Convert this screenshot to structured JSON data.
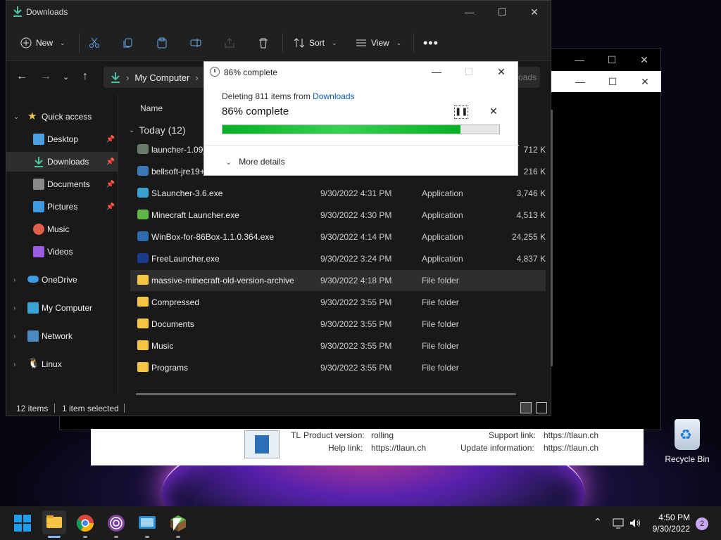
{
  "explorer": {
    "title": "Downloads",
    "toolbar": {
      "new_label": "New",
      "sort_label": "Sort",
      "view_label": "View"
    },
    "address": {
      "root": "My Computer",
      "tail": "oads"
    },
    "nav": {
      "quick_access": "Quick access",
      "desktop": "Desktop",
      "downloads": "Downloads",
      "documents": "Documents",
      "pictures": "Pictures",
      "music": "Music",
      "videos": "Videos",
      "onedrive": "OneDrive",
      "mycomputer": "My Computer",
      "network": "Network",
      "linux": "Linux"
    },
    "column_name": "Name",
    "group_label": "Today (12)",
    "files": [
      {
        "name": "launcher-1.09_1",
        "date": "",
        "type": "",
        "size": "712 K"
      },
      {
        "name": "bellsoft-jre19+3",
        "date": "",
        "type": "",
        "size": "216 K"
      },
      {
        "name": "SLauncher-3.6.exe",
        "date": "9/30/2022 4:31 PM",
        "type": "Application",
        "size": "3,746 K"
      },
      {
        "name": "Minecraft Launcher.exe",
        "date": "9/30/2022 4:30 PM",
        "type": "Application",
        "size": "4,513 K"
      },
      {
        "name": "WinBox-for-86Box-1.1.0.364.exe",
        "date": "9/30/2022 4:14 PM",
        "type": "Application",
        "size": "24,255 K"
      },
      {
        "name": "FreeLauncher.exe",
        "date": "9/30/2022 3:24 PM",
        "type": "Application",
        "size": "4,837 K"
      },
      {
        "name": "massive-minecraft-old-version-archive",
        "date": "9/30/2022 4:18 PM",
        "type": "File folder",
        "size": ""
      },
      {
        "name": "Compressed",
        "date": "9/30/2022 3:55 PM",
        "type": "File folder",
        "size": ""
      },
      {
        "name": "Documents",
        "date": "9/30/2022 3:55 PM",
        "type": "File folder",
        "size": ""
      },
      {
        "name": "Music",
        "date": "9/30/2022 3:55 PM",
        "type": "File folder",
        "size": ""
      },
      {
        "name": "Programs",
        "date": "9/30/2022 3:55 PM",
        "type": "File folder",
        "size": ""
      }
    ],
    "status": {
      "count": "12 items",
      "selected": "1 item selected"
    }
  },
  "dialog": {
    "title": "86% complete",
    "line1_prefix": "Deleting 811 items from ",
    "line1_link": "Downloads",
    "percent_text": "86% complete",
    "progress": 0.86,
    "more_details": "More details"
  },
  "info_window": {
    "tl_label": "TL",
    "product_version_label": "Product version:",
    "product_version": "rolling",
    "help_link_label": "Help link:",
    "help_link": "https://tlaun.ch",
    "support_link_label": "Support link:",
    "support_link": "https://tlaun.ch",
    "update_info_label": "Update information:",
    "update_info": "https://tlaun.ch"
  },
  "desktop": {
    "recycle_bin": "Recycle Bin"
  },
  "taskbar": {
    "time": "4:50 PM",
    "date": "9/30/2022",
    "notifications": "2"
  },
  "colors": {
    "accent_green": "#06b025",
    "folder": "#f4c542",
    "link": "#0a5ab8"
  }
}
